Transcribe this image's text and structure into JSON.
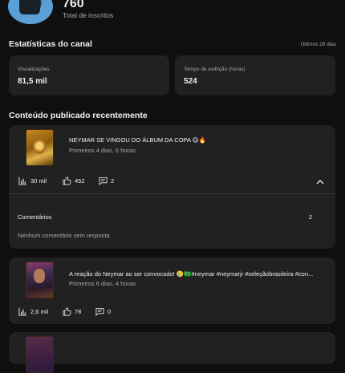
{
  "channel": {
    "subscriber_count": "760",
    "subscriber_label": "Total de inscritos"
  },
  "stats": {
    "title": "Estatísticas do canal",
    "period": "Últimos 28 dias",
    "views_label": "Visualizações",
    "views_value": "81,5 mil",
    "watch_label": "Tempo de exibição (horas)",
    "watch_value": "524"
  },
  "recent": {
    "title": "Conteúdo publicado recentemente",
    "videos": [
      {
        "title": "NEYMAR SE VINGOU DO ÁLBUM DA COPA 😋🔥",
        "age": "Primeiros 4 dias, 6 horas",
        "views": "30 mil",
        "likes": "452",
        "comments": "2",
        "comments_label": "Comentários",
        "comments_count": "2",
        "no_reply": "Nenhum comentário sem resposta"
      },
      {
        "title": "A reação do Neymar ao ser convocado! 🥲🇧🇷#neymar #neymarjr #seleçãobrasileira #con...",
        "age": "Primeiros 6 dias, 4 horas",
        "views": "2,6 mil",
        "likes": "78",
        "comments": "0"
      }
    ]
  },
  "icons": {
    "views": "bar-chart-icon",
    "likes": "thumbs-up-icon",
    "comments": "comment-icon",
    "expand": "chevron-up-icon"
  }
}
